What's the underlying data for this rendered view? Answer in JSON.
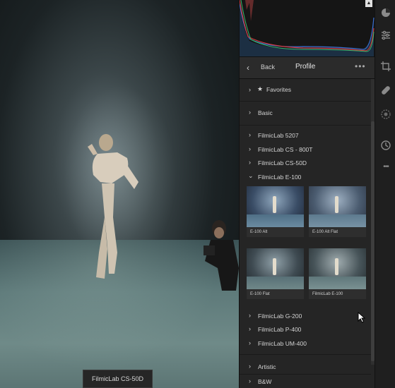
{
  "panel": {
    "header": {
      "back_label": "Back",
      "title": "Profile"
    },
    "groups": {
      "favorites": "Favorites",
      "basic": "Basic",
      "filmiclab_5207": "FilmicLab 5207",
      "filmiclab_cs_800t": "FilmicLab CS - 800T",
      "filmiclab_cs_50d": "FilmicLab CS-50D",
      "filmiclab_e100": "FilmicLab E-100",
      "filmiclab_g200": "FilmicLab G-200",
      "filmiclab_p400": "FilmicLab P-400",
      "filmiclab_um400": "FilmicLab UM-400",
      "artistic": "Artistic",
      "bw": "B&W"
    },
    "thumbnails": [
      "E-100 Alt",
      "E-100 Alt Flat",
      "E-100 Flat",
      "FilmicLab E-100"
    ]
  },
  "tooltip": "FilmicLab CS-50D",
  "colors": {
    "panel_bg": "#252525",
    "histogram_red": "#d23a3a",
    "histogram_blue": "#3a6fd2",
    "histogram_green": "#35b56b"
  },
  "icons": [
    "back-icon",
    "more-icon",
    "star-icon",
    "chevron-right-icon",
    "chevron-down-icon",
    "edit-circle-icon",
    "sliders-icon",
    "crop-icon",
    "healing-icon",
    "masking-icon",
    "history-icon",
    "more-vertical-icon",
    "cursor-icon"
  ]
}
